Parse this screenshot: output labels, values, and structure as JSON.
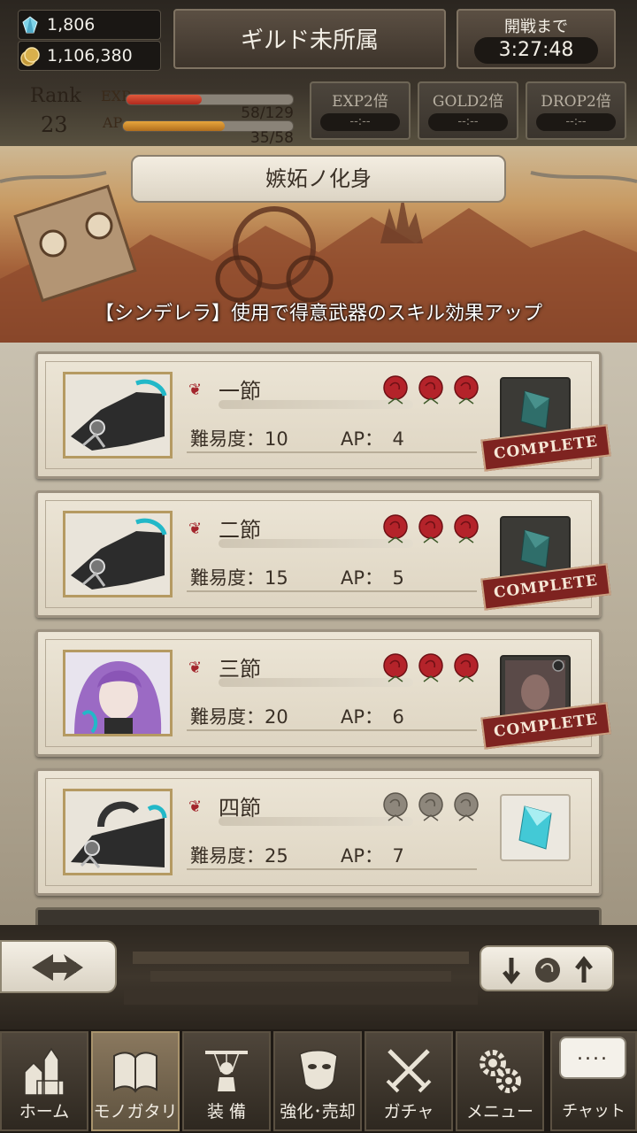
{
  "header": {
    "gems": "1,806",
    "gold": "1,106,380",
    "guild": "ギルド未所属",
    "battle_label": "開戦まで",
    "battle_timer": "3:27:48",
    "rank_label": "Rank",
    "rank_value": "23",
    "exp_label": "EXP",
    "exp_value": "58/129",
    "exp_fraction": 0.45,
    "ap_label": "AP",
    "ap_value": "35/58",
    "ap_fraction": 0.6,
    "boosts": [
      {
        "label": "EXP2倍",
        "timer": "--:--"
      },
      {
        "label": "GOLD2倍",
        "timer": "--:--"
      },
      {
        "label": "DROP2倍",
        "timer": "--:--"
      }
    ]
  },
  "banner": {
    "title": "嫉妬ノ化身",
    "caption": "【シンデレラ】使用で得意武器のスキル効果アップ"
  },
  "chapters": [
    {
      "name": "一節",
      "difficulty": "難易度：10",
      "ap": "AP：　4",
      "roses_active": true,
      "complete": "COMPLETE"
    },
    {
      "name": "二節",
      "difficulty": "難易度：15",
      "ap": "AP：　5",
      "roses_active": true,
      "complete": "COMPLETE"
    },
    {
      "name": "三節",
      "difficulty": "難易度：20",
      "ap": "AP：　6",
      "roses_active": true,
      "complete": "COMPLETE"
    },
    {
      "name": "四節",
      "difficulty": "難易度：25",
      "ap": "AP：　7",
      "roses_active": false,
      "complete": ""
    }
  ],
  "nav": [
    {
      "label": "ホーム",
      "icon": "castle-icon"
    },
    {
      "label": "モノガタリ",
      "icon": "book-icon"
    },
    {
      "label": "装 備",
      "icon": "puppet-icon"
    },
    {
      "label": "強化･売却",
      "icon": "mask-icon"
    },
    {
      "label": "ガチャ",
      "icon": "swords-icon"
    },
    {
      "label": "メニュー",
      "icon": "gears-icon"
    }
  ],
  "chat": {
    "bubble": "....",
    "label": "チャット"
  },
  "colors": {
    "exp_bar": "#c8382a",
    "ap_bar": "#c8892a",
    "complete_stamp": "#7e2320",
    "rose": "#a3252c"
  }
}
